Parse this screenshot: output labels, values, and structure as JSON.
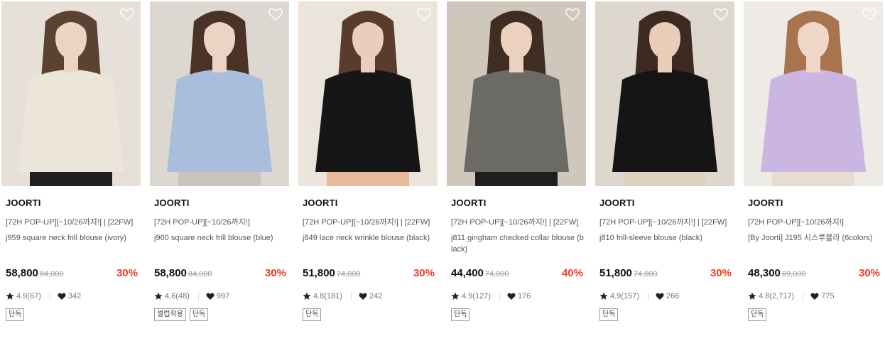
{
  "products": [
    {
      "brand": "JOORTI",
      "promo": "[72H POP-UP][~10/26까지!] | [22FW]",
      "name": "j959 square neck frill blouse (ivory)",
      "price": "58,800",
      "original_price": "84,000",
      "discount": "30%",
      "rating": "4.9(67)",
      "likes": "342",
      "badges": [
        "단독"
      ],
      "colors": {
        "bg": "#e6e0d8",
        "top": "#ece5da",
        "hair": "#5b4232",
        "skin": "#ecd3c2",
        "bottom": "#1e1e1e"
      }
    },
    {
      "brand": "JOORTI",
      "promo": "[72H POP-UP][~10/26까지!]",
      "name": "j960 square neck frill blouse (blue)",
      "price": "58,800",
      "original_price": "84,000",
      "discount": "30%",
      "rating": "4.6(48)",
      "likes": "997",
      "badges": [
        "셀럽착용",
        "단독"
      ],
      "colors": {
        "bg": "#dcd7d0",
        "top": "#a9bddc",
        "hair": "#4a3226",
        "skin": "#ecd3c4",
        "bottom": "#c9c4bd"
      }
    },
    {
      "brand": "JOORTI",
      "promo": "[72H POP-UP][~10/26까지!] | [22FW]",
      "name": "j849 lace neck wrinkle blouse (black)",
      "price": "51,800",
      "original_price": "74,000",
      "discount": "30%",
      "rating": "4.8(181)",
      "likes": "242",
      "badges": [
        "단독"
      ],
      "colors": {
        "bg": "#ebe4da",
        "top": "#161616",
        "hair": "#5a3c2c",
        "skin": "#ebcdbb",
        "bottom": "#e8b99a"
      }
    },
    {
      "brand": "JOORTI",
      "promo": "[72H POP-UP][~10/26까지!] | [22FW]",
      "name": "j811 gingham checked collar blouse (black)",
      "price": "44,400",
      "original_price": "74,000",
      "discount": "40%",
      "rating": "4.9(127)",
      "likes": "176",
      "badges": [
        "단독"
      ],
      "colors": {
        "bg": "#cfc7bb",
        "top": "#6b6a64",
        "hair": "#3f2c22",
        "skin": "#ecd1bf",
        "bottom": "#1e1e1e"
      }
    },
    {
      "brand": "JOORTI",
      "promo": "[72H POP-UP][~10/26까지!] | [22FW]",
      "name": "j810 frill-sleeve blouse (black)",
      "price": "51,800",
      "original_price": "74,000",
      "discount": "30%",
      "rating": "4.9(157)",
      "likes": "266",
      "badges": [
        "단독"
      ],
      "colors": {
        "bg": "#ddd7cd",
        "top": "#151515",
        "hair": "#3d2a20",
        "skin": "#eacdb9",
        "bottom": "#ddd2bf"
      }
    },
    {
      "brand": "JOORTI",
      "promo": "[72H POP-UP][~10/26까지!]",
      "name": "[By Joorti] J195 시스루블라 (6colors)",
      "price": "48,300",
      "original_price": "69,000",
      "discount": "30%",
      "rating": "4.8(2,717)",
      "likes": "775",
      "badges": [
        "단독"
      ],
      "colors": {
        "bg": "#eeeae6",
        "top": "#cbb6e2",
        "hair": "#a8744f",
        "skin": "#efd6c6",
        "bottom": "#e6ddd0"
      }
    }
  ]
}
